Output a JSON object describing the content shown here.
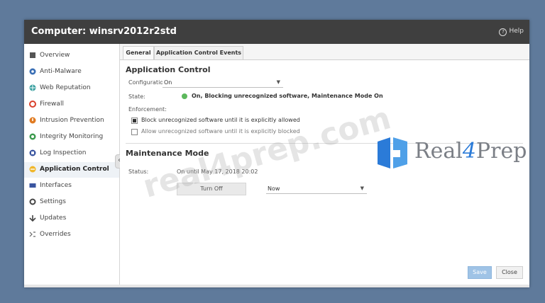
{
  "window": {
    "title": "Computer: winsrv2012r2std",
    "help_label": "Help"
  },
  "sidebar": {
    "items": [
      {
        "label": "Overview",
        "icon": "overview-icon",
        "color": "#555555"
      },
      {
        "label": "Anti-Malware",
        "icon": "anti-malware-icon",
        "color": "#3a6fb5"
      },
      {
        "label": "Web Reputation",
        "icon": "web-reputation-icon",
        "color": "#3aa0a0"
      },
      {
        "label": "Firewall",
        "icon": "firewall-icon",
        "color": "#d9402b"
      },
      {
        "label": "Intrusion Prevention",
        "icon": "intrusion-prevention-icon",
        "color": "#e07b22"
      },
      {
        "label": "Integrity Monitoring",
        "icon": "integrity-monitoring-icon",
        "color": "#3c9a4d"
      },
      {
        "label": "Log Inspection",
        "icon": "log-inspection-icon",
        "color": "#3a55a0"
      },
      {
        "label": "Application Control",
        "icon": "application-control-icon",
        "color": "#f0b62a",
        "active": true
      },
      {
        "label": "Interfaces",
        "icon": "interfaces-icon",
        "color": "#3a55a0"
      },
      {
        "label": "Settings",
        "icon": "settings-icon",
        "color": "#444444"
      },
      {
        "label": "Updates",
        "icon": "updates-icon",
        "color": "#444444"
      },
      {
        "label": "Overrides",
        "icon": "overrides-icon",
        "color": "#666666"
      }
    ]
  },
  "tabs": [
    {
      "label": "General",
      "active": true
    },
    {
      "label": "Application Control Events",
      "active": false
    }
  ],
  "app_control": {
    "section_title": "Application Control",
    "configuration_label": "Configuration:",
    "configuration_value": "On",
    "state_label": "State:",
    "state_value": "On, Blocking unrecognized software, Maintenance Mode On",
    "state_color": "#5cb85c",
    "enforcement_label": "Enforcement:",
    "enforcement_options": [
      {
        "label": "Block unrecognized software until it is explicitly allowed",
        "checked": true
      },
      {
        "label": "Allow unrecognized software until it is explicitly blocked",
        "checked": false
      }
    ]
  },
  "maintenance": {
    "section_title": "Maintenance Mode",
    "status_label": "Status:",
    "status_value": "On until May 17, 2018 20:02",
    "turn_off_label": "Turn Off",
    "duration_value": "Now"
  },
  "footer": {
    "save_label": "Save",
    "close_label": "Close"
  },
  "watermark": {
    "diagonal_text": "real4prep.com",
    "brand_prefix": "Real",
    "brand_number": "4",
    "brand_suffix": "Prep"
  }
}
